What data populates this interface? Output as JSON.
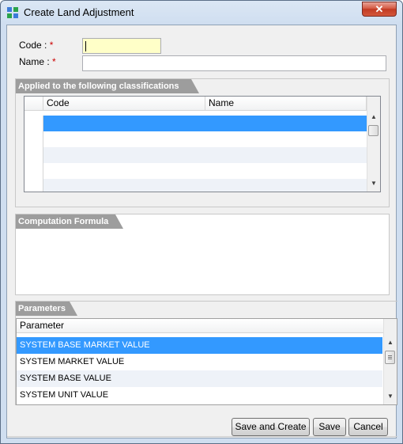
{
  "window": {
    "title": "Create Land Adjustment",
    "close_label": "✕",
    "icon": "app-icon"
  },
  "form": {
    "code_label": "Code :",
    "name_label": "Name :",
    "required_mark": "*",
    "code_value": "",
    "name_value": ""
  },
  "classifications": {
    "title": "Applied to the following classifications",
    "columns": [
      "Code",
      "Name"
    ],
    "rows": [
      {
        "code": "",
        "name": ""
      },
      {
        "code": "",
        "name": ""
      },
      {
        "code": "",
        "name": ""
      },
      {
        "code": "",
        "name": ""
      }
    ]
  },
  "formula": {
    "title": "Computation Formula",
    "value": ""
  },
  "parameters": {
    "title": "Parameters",
    "column": "Parameter",
    "items": [
      "SYSTEM BASE MARKET VALUE",
      "SYSTEM MARKET VALUE",
      "SYSTEM BASE VALUE",
      "SYSTEM UNIT VALUE"
    ],
    "selected_index": 0
  },
  "buttons": {
    "save_create": "Save and Create",
    "save": "Save",
    "cancel": "Cancel"
  },
  "colors": {
    "selection": "#3399ff",
    "required": "#cc0000",
    "panel_header": "#9d9d9d",
    "code_field_bg": "#ffffc8"
  }
}
